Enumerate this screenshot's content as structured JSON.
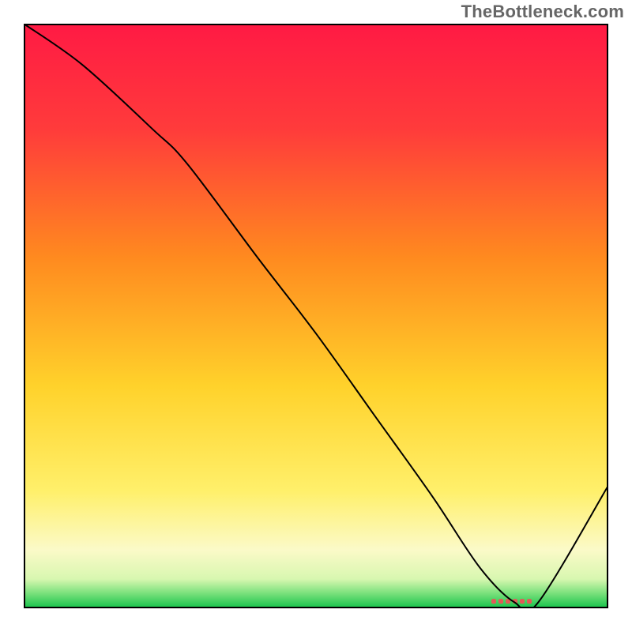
{
  "watermark": "TheBottleneck.com",
  "chart_data": {
    "type": "line",
    "title": "",
    "xlabel": "",
    "ylabel": "",
    "xlim": [
      0,
      100
    ],
    "ylim": [
      0,
      100
    ],
    "grid": false,
    "legend": false,
    "background": {
      "type": "vertical-gradient",
      "description": "Red at top blending through orange and yellow to pale yellow near bottom, with thin green band at the very bottom",
      "stops": [
        {
          "offset": 0.0,
          "color": "#ff1a44"
        },
        {
          "offset": 0.18,
          "color": "#ff3b3b"
        },
        {
          "offset": 0.4,
          "color": "#ff8a1f"
        },
        {
          "offset": 0.62,
          "color": "#ffd22b"
        },
        {
          "offset": 0.8,
          "color": "#fff06b"
        },
        {
          "offset": 0.9,
          "color": "#fbfac8"
        },
        {
          "offset": 0.95,
          "color": "#d8f7b0"
        },
        {
          "offset": 0.975,
          "color": "#77e07a"
        },
        {
          "offset": 1.0,
          "color": "#14c24a"
        }
      ]
    },
    "series": [
      {
        "name": "bottleneck-curve",
        "color": "#000000",
        "stroke_width": 2,
        "x": [
          0,
          10,
          22,
          28,
          40,
          50,
          60,
          70,
          78,
          84,
          88,
          100
        ],
        "y": [
          100,
          93,
          82,
          76,
          60,
          47,
          33,
          19,
          7,
          1,
          1,
          21
        ]
      }
    ],
    "annotations": [
      {
        "name": "valley-marker",
        "x_range": [
          80,
          88
        ],
        "y": 1.2,
        "color": "#e25a57",
        "style": "dashed-bar"
      }
    ]
  }
}
